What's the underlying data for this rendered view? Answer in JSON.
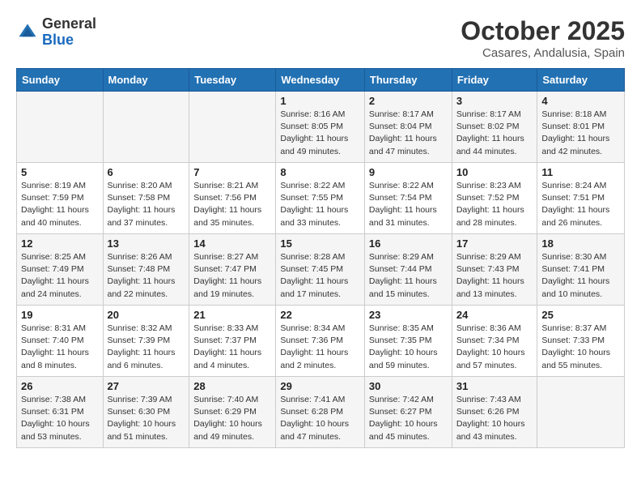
{
  "header": {
    "logo_general": "General",
    "logo_blue": "Blue",
    "month_title": "October 2025",
    "location": "Casares, Andalusia, Spain"
  },
  "days_of_week": [
    "Sunday",
    "Monday",
    "Tuesday",
    "Wednesday",
    "Thursday",
    "Friday",
    "Saturday"
  ],
  "weeks": [
    [
      {
        "day": "",
        "info": ""
      },
      {
        "day": "",
        "info": ""
      },
      {
        "day": "",
        "info": ""
      },
      {
        "day": "1",
        "info": "Sunrise: 8:16 AM\nSunset: 8:05 PM\nDaylight: 11 hours and 49 minutes."
      },
      {
        "day": "2",
        "info": "Sunrise: 8:17 AM\nSunset: 8:04 PM\nDaylight: 11 hours and 47 minutes."
      },
      {
        "day": "3",
        "info": "Sunrise: 8:17 AM\nSunset: 8:02 PM\nDaylight: 11 hours and 44 minutes."
      },
      {
        "day": "4",
        "info": "Sunrise: 8:18 AM\nSunset: 8:01 PM\nDaylight: 11 hours and 42 minutes."
      }
    ],
    [
      {
        "day": "5",
        "info": "Sunrise: 8:19 AM\nSunset: 7:59 PM\nDaylight: 11 hours and 40 minutes."
      },
      {
        "day": "6",
        "info": "Sunrise: 8:20 AM\nSunset: 7:58 PM\nDaylight: 11 hours and 37 minutes."
      },
      {
        "day": "7",
        "info": "Sunrise: 8:21 AM\nSunset: 7:56 PM\nDaylight: 11 hours and 35 minutes."
      },
      {
        "day": "8",
        "info": "Sunrise: 8:22 AM\nSunset: 7:55 PM\nDaylight: 11 hours and 33 minutes."
      },
      {
        "day": "9",
        "info": "Sunrise: 8:22 AM\nSunset: 7:54 PM\nDaylight: 11 hours and 31 minutes."
      },
      {
        "day": "10",
        "info": "Sunrise: 8:23 AM\nSunset: 7:52 PM\nDaylight: 11 hours and 28 minutes."
      },
      {
        "day": "11",
        "info": "Sunrise: 8:24 AM\nSunset: 7:51 PM\nDaylight: 11 hours and 26 minutes."
      }
    ],
    [
      {
        "day": "12",
        "info": "Sunrise: 8:25 AM\nSunset: 7:49 PM\nDaylight: 11 hours and 24 minutes."
      },
      {
        "day": "13",
        "info": "Sunrise: 8:26 AM\nSunset: 7:48 PM\nDaylight: 11 hours and 22 minutes."
      },
      {
        "day": "14",
        "info": "Sunrise: 8:27 AM\nSunset: 7:47 PM\nDaylight: 11 hours and 19 minutes."
      },
      {
        "day": "15",
        "info": "Sunrise: 8:28 AM\nSunset: 7:45 PM\nDaylight: 11 hours and 17 minutes."
      },
      {
        "day": "16",
        "info": "Sunrise: 8:29 AM\nSunset: 7:44 PM\nDaylight: 11 hours and 15 minutes."
      },
      {
        "day": "17",
        "info": "Sunrise: 8:29 AM\nSunset: 7:43 PM\nDaylight: 11 hours and 13 minutes."
      },
      {
        "day": "18",
        "info": "Sunrise: 8:30 AM\nSunset: 7:41 PM\nDaylight: 11 hours and 10 minutes."
      }
    ],
    [
      {
        "day": "19",
        "info": "Sunrise: 8:31 AM\nSunset: 7:40 PM\nDaylight: 11 hours and 8 minutes."
      },
      {
        "day": "20",
        "info": "Sunrise: 8:32 AM\nSunset: 7:39 PM\nDaylight: 11 hours and 6 minutes."
      },
      {
        "day": "21",
        "info": "Sunrise: 8:33 AM\nSunset: 7:37 PM\nDaylight: 11 hours and 4 minutes."
      },
      {
        "day": "22",
        "info": "Sunrise: 8:34 AM\nSunset: 7:36 PM\nDaylight: 11 hours and 2 minutes."
      },
      {
        "day": "23",
        "info": "Sunrise: 8:35 AM\nSunset: 7:35 PM\nDaylight: 10 hours and 59 minutes."
      },
      {
        "day": "24",
        "info": "Sunrise: 8:36 AM\nSunset: 7:34 PM\nDaylight: 10 hours and 57 minutes."
      },
      {
        "day": "25",
        "info": "Sunrise: 8:37 AM\nSunset: 7:33 PM\nDaylight: 10 hours and 55 minutes."
      }
    ],
    [
      {
        "day": "26",
        "info": "Sunrise: 7:38 AM\nSunset: 6:31 PM\nDaylight: 10 hours and 53 minutes."
      },
      {
        "day": "27",
        "info": "Sunrise: 7:39 AM\nSunset: 6:30 PM\nDaylight: 10 hours and 51 minutes."
      },
      {
        "day": "28",
        "info": "Sunrise: 7:40 AM\nSunset: 6:29 PM\nDaylight: 10 hours and 49 minutes."
      },
      {
        "day": "29",
        "info": "Sunrise: 7:41 AM\nSunset: 6:28 PM\nDaylight: 10 hours and 47 minutes."
      },
      {
        "day": "30",
        "info": "Sunrise: 7:42 AM\nSunset: 6:27 PM\nDaylight: 10 hours and 45 minutes."
      },
      {
        "day": "31",
        "info": "Sunrise: 7:43 AM\nSunset: 6:26 PM\nDaylight: 10 hours and 43 minutes."
      },
      {
        "day": "",
        "info": ""
      }
    ]
  ]
}
